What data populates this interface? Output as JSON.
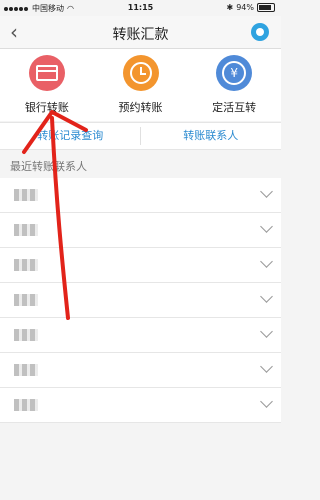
{
  "status": {
    "carrier": "中国移动",
    "time": "11:15",
    "battery": "94%"
  },
  "header": {
    "title": "转账汇款"
  },
  "actions": [
    {
      "label": "银行转账"
    },
    {
      "label": "预约转账"
    },
    {
      "label": "定活互转"
    }
  ],
  "links": {
    "history": "转账记录查询",
    "contacts": "转账联系人"
  },
  "section": {
    "title": "最近转账联系人"
  },
  "contacts_count_visible": 7
}
